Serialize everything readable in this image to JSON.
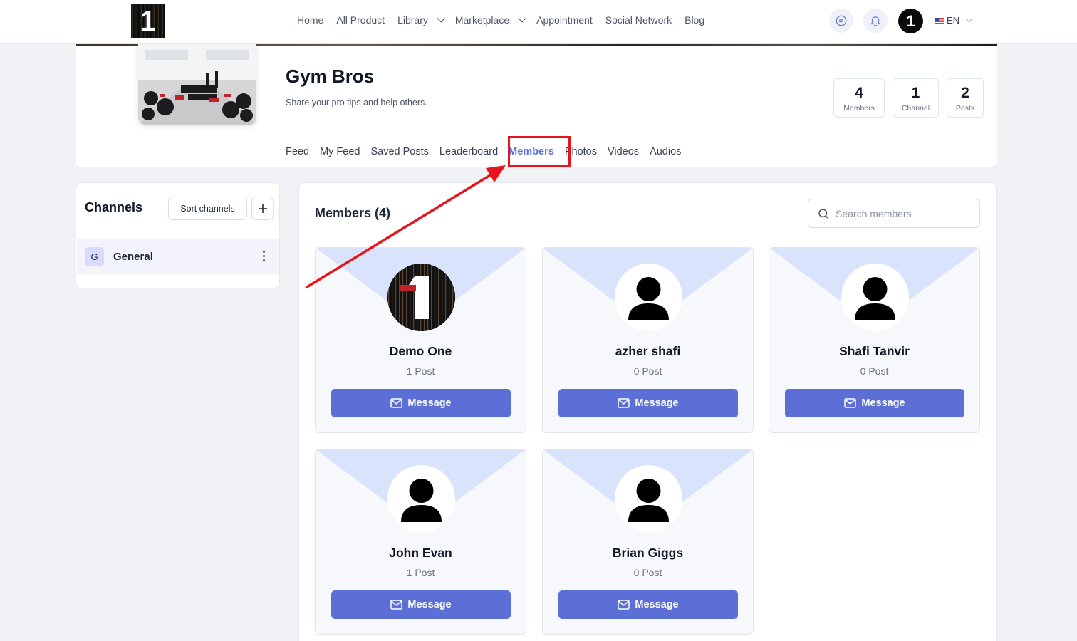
{
  "nav": {
    "items": [
      {
        "label": "Home",
        "dropdown": false
      },
      {
        "label": "All Product",
        "dropdown": false
      },
      {
        "label": "Library",
        "dropdown": true
      },
      {
        "label": "Marketplace",
        "dropdown": true
      },
      {
        "label": "Appointment",
        "dropdown": false
      },
      {
        "label": "Social Network",
        "dropdown": false
      },
      {
        "label": "Blog",
        "dropdown": false
      }
    ],
    "language": "EN",
    "logo_text": "1",
    "avatar_text": "1"
  },
  "group": {
    "title": "Gym Bros",
    "subtitle": "Share your pro tips and help others.",
    "stats": [
      {
        "value": "4",
        "label": "Members"
      },
      {
        "value": "1",
        "label": "Channel"
      },
      {
        "value": "2",
        "label": "Posts"
      }
    ],
    "tabs": [
      "Feed",
      "My Feed",
      "Saved Posts",
      "Leaderboard",
      "Members",
      "Photos",
      "Videos",
      "Audios"
    ],
    "active_tab": "Members"
  },
  "channels": {
    "title": "Channels",
    "sort_label": "Sort channels",
    "items": [
      {
        "badge": "G",
        "name": "General"
      }
    ]
  },
  "members": {
    "title": "Members (4)",
    "search_placeholder": "Search members",
    "message_label": "Message",
    "list": [
      {
        "name": "Demo One",
        "posts": "1 Post",
        "avatar": "demo"
      },
      {
        "name": "azher shafi",
        "posts": "0 Post",
        "avatar": "default"
      },
      {
        "name": "Shafi Tanvir",
        "posts": "0 Post",
        "avatar": "default"
      },
      {
        "name": "John Evan",
        "posts": "1 Post",
        "avatar": "default"
      },
      {
        "name": "Brian Giggs",
        "posts": "0 Post",
        "avatar": "default"
      }
    ]
  },
  "colors": {
    "accent": "#5b6fd6",
    "highlight": "#e8141c",
    "card_triangle": "#d9e3fb"
  }
}
